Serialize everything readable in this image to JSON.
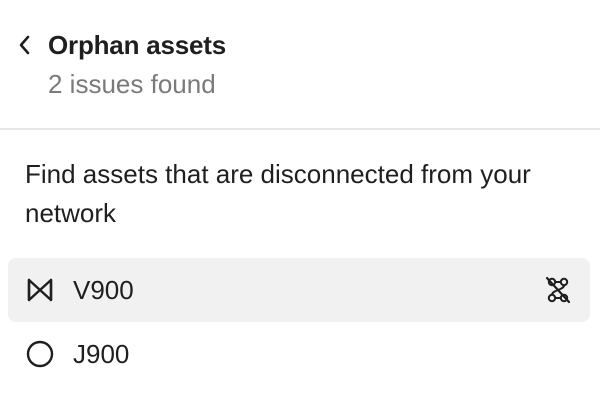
{
  "header": {
    "back_icon": "chevron-left-icon",
    "title": "Orphan assets",
    "subtitle": "2 issues found"
  },
  "description": "Find assets that are disconnected from your network",
  "assets": [
    {
      "label": "V900",
      "icon": "valve-icon",
      "selected": true,
      "action_icon": "disconnected-route-icon"
    },
    {
      "label": "J900",
      "icon": "junction-circle-icon",
      "selected": false
    }
  ],
  "colors": {
    "text": "#1f1f1f",
    "muted": "#7a7a7a",
    "divider": "#e6e6e6",
    "selected_bg": "#f1f1f1"
  }
}
